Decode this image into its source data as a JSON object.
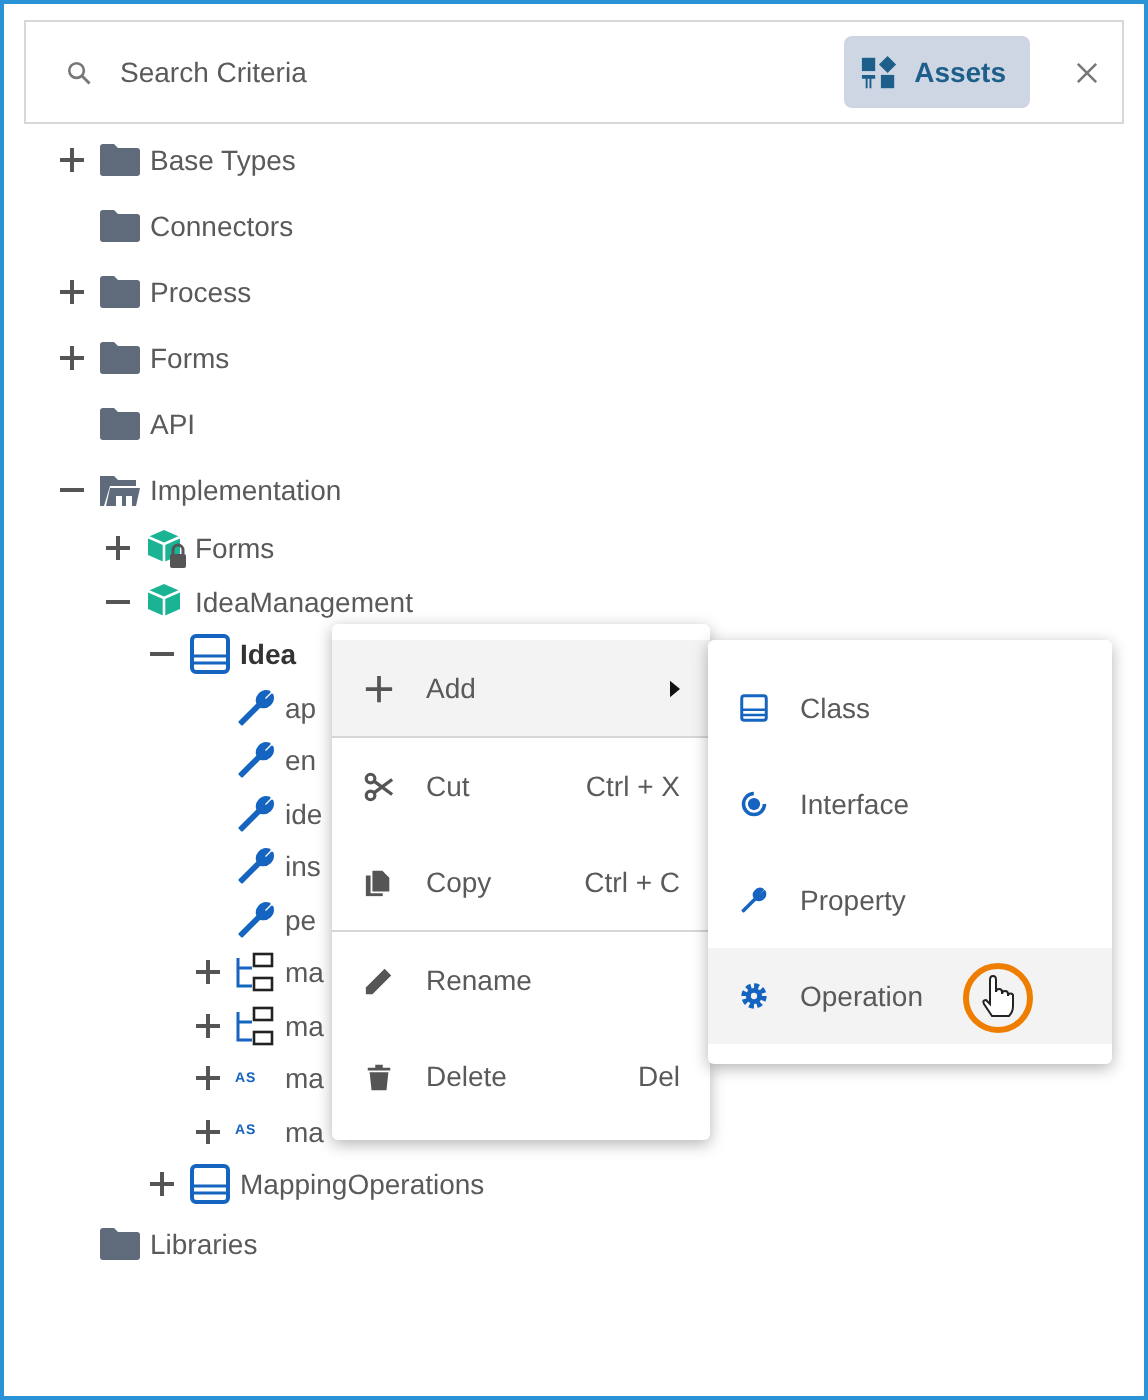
{
  "search": {
    "placeholder": "Search Criteria",
    "assets_button": "Assets"
  },
  "tree": [
    {
      "label": "Base Types",
      "kind": "folder",
      "expanded": false
    },
    {
      "label": "Connectors",
      "kind": "folder"
    },
    {
      "label": "Process",
      "kind": "folder",
      "expanded": false
    },
    {
      "label": "Forms",
      "kind": "folder",
      "expanded": false
    },
    {
      "label": "API",
      "kind": "folder"
    },
    {
      "label": "Implementation",
      "kind": "implementation",
      "expanded": true,
      "children": [
        {
          "label": "Forms",
          "kind": "locked",
          "expanded": false
        },
        {
          "label": "IdeaManagement",
          "kind": "package",
          "expanded": true,
          "children": [
            {
              "label": "Idea",
              "kind": "class",
              "expanded": true,
              "bold": true,
              "children": [
                {
                  "label": "ap",
                  "kind": "property"
                },
                {
                  "label": "en",
                  "kind": "property"
                },
                {
                  "label": "ide",
                  "kind": "property"
                },
                {
                  "label": "ins",
                  "kind": "property"
                },
                {
                  "label": "pe",
                  "kind": "property"
                },
                {
                  "label": "ma",
                  "kind": "mapping",
                  "expanded": false
                },
                {
                  "label": "ma",
                  "kind": "mapping",
                  "expanded": false
                },
                {
                  "label": "ma",
                  "kind": "script",
                  "badge": "AS",
                  "expanded": false
                },
                {
                  "label": "ma",
                  "kind": "script",
                  "badge": "AS",
                  "expanded": false
                }
              ]
            },
            {
              "label": "MappingOperations",
              "kind": "class",
              "expanded": false
            }
          ]
        }
      ]
    },
    {
      "label": "Libraries",
      "kind": "folder"
    }
  ],
  "context_menu": {
    "groups": [
      [
        {
          "label": "Add",
          "kind": "add",
          "submenu": true,
          "selected": true
        }
      ],
      [
        {
          "label": "Cut",
          "kind": "cut",
          "shortcut": "Ctrl + X",
          "selected": false
        },
        {
          "label": "Copy",
          "kind": "copy",
          "shortcut": "Ctrl + C",
          "selected": false
        }
      ],
      [
        {
          "label": "Rename",
          "kind": "rename",
          "selected": false
        },
        {
          "label": "Delete",
          "kind": "delete",
          "shortcut": "Del",
          "selected": false
        }
      ]
    ]
  },
  "submenu": [
    {
      "label": "Class",
      "kind": "class",
      "selected": false
    },
    {
      "label": "Interface",
      "kind": "interface",
      "selected": false
    },
    {
      "label": "Property",
      "kind": "property",
      "selected": false
    },
    {
      "label": "Operation",
      "kind": "operation",
      "selected": true
    }
  ]
}
